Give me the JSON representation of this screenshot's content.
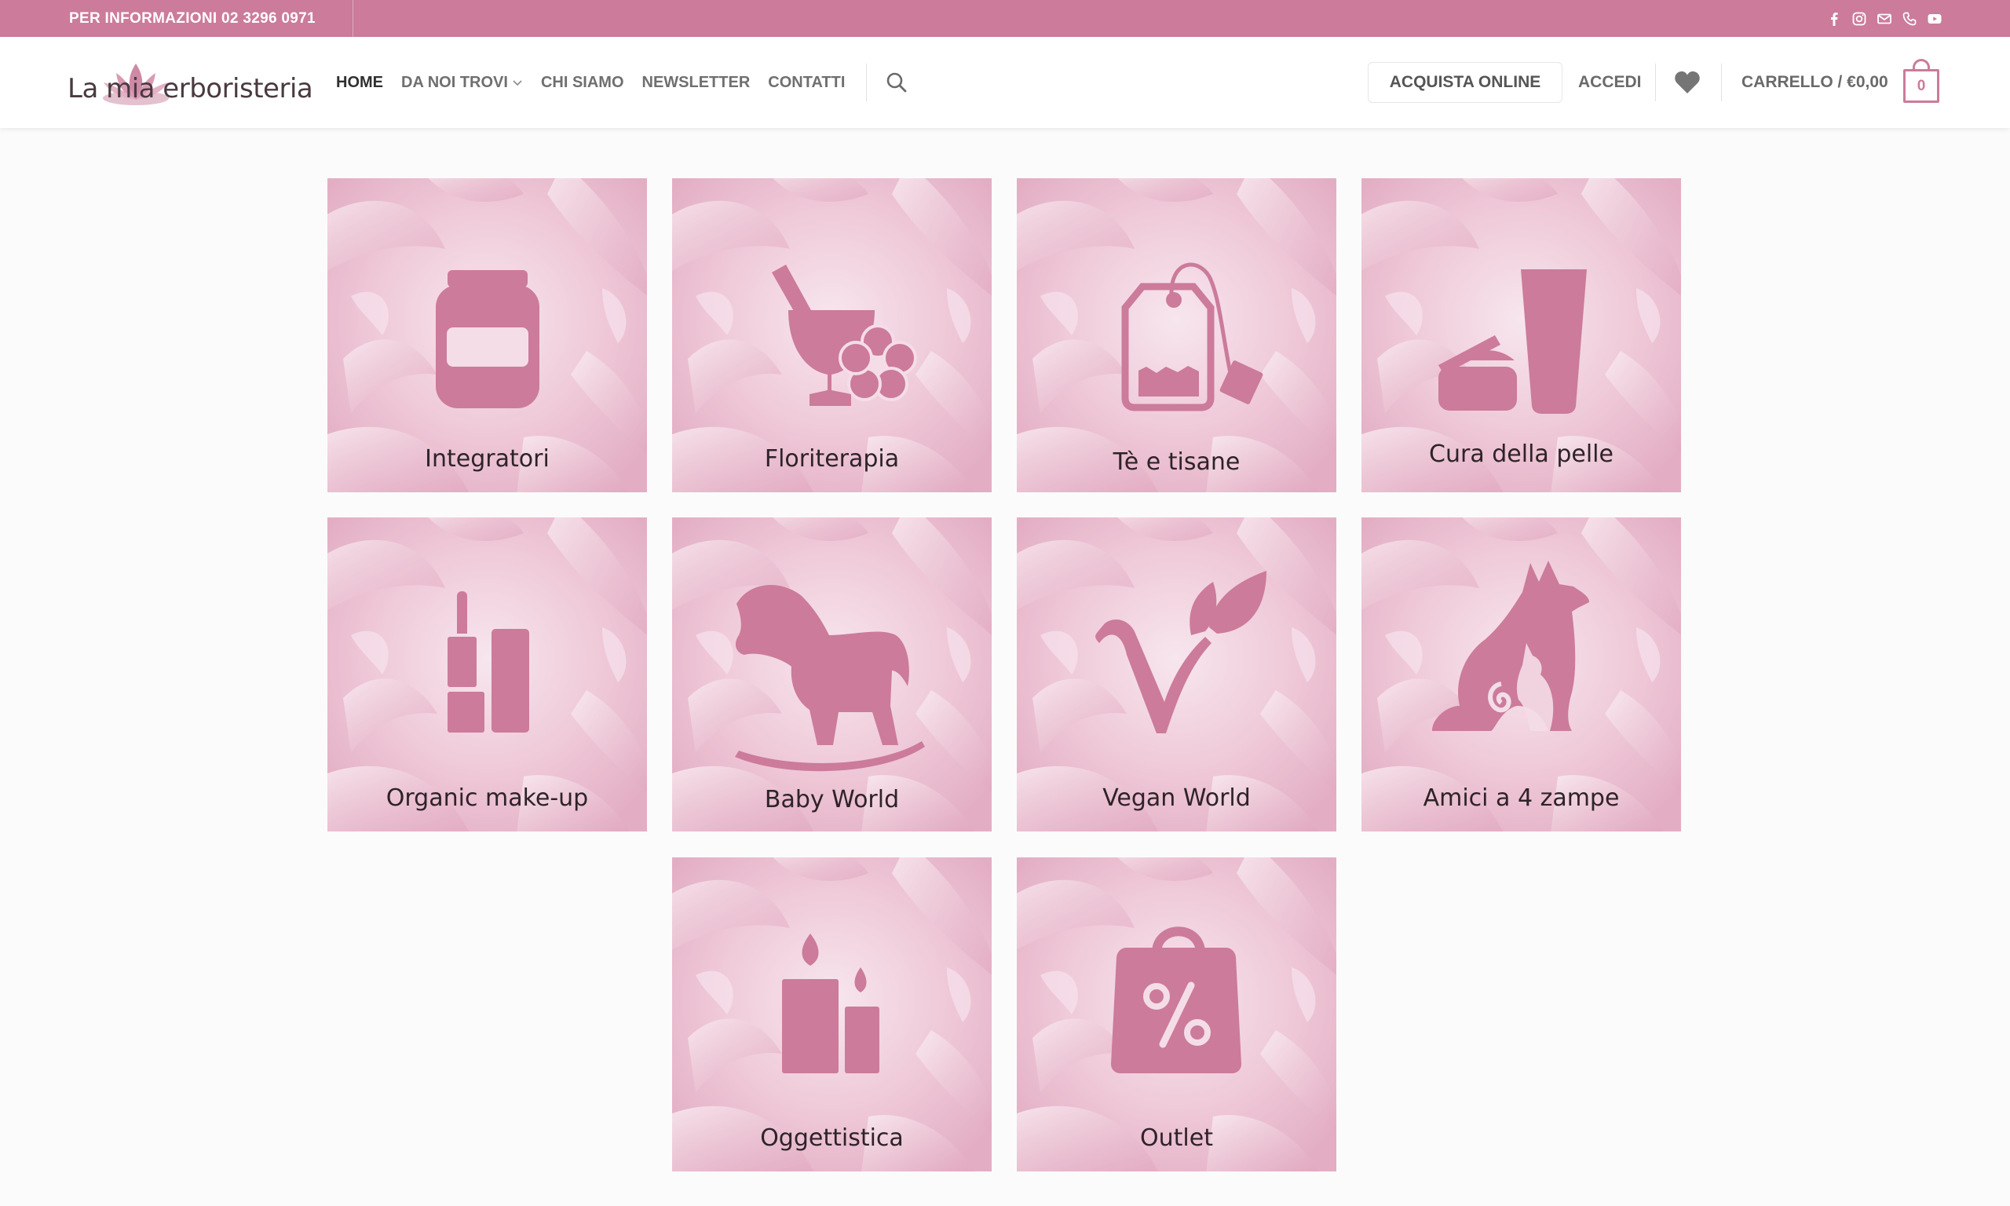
{
  "topbar": {
    "info": "PER INFORMAZIONI 02 3296 0971",
    "social_icons": [
      "facebook-icon",
      "instagram-icon",
      "email-icon",
      "phone-icon",
      "youtube-icon"
    ]
  },
  "header": {
    "logo_text": "La mia erboristeria",
    "nav": [
      {
        "label": "HOME",
        "active": true
      },
      {
        "label": "DA NOI TROVI",
        "has_dropdown": true
      },
      {
        "label": "CHI SIAMO"
      },
      {
        "label": "NEWSLETTER"
      },
      {
        "label": "CONTATTI"
      }
    ],
    "buy_online": "ACQUISTA ONLINE",
    "login": "ACCEDI",
    "cart_label": "CARRELLO / €0,00",
    "cart_count": "0"
  },
  "colors": {
    "brand": "#cc7b9a",
    "tile_background": "#f0cfdc",
    "icon": "#cc7b9a",
    "label": "#2e2328"
  },
  "categories": [
    {
      "label": "Integratori",
      "icon": "supplement-jar-icon"
    },
    {
      "label": "Floriterapia",
      "icon": "mortar-flower-icon"
    },
    {
      "label": "Tè e tisane",
      "icon": "tea-bag-icon"
    },
    {
      "label": "Cura della pelle",
      "icon": "skincare-icon"
    },
    {
      "label": "Organic make-up",
      "icon": "lipstick-icon"
    },
    {
      "label": "Baby World",
      "icon": "rocking-horse-icon"
    },
    {
      "label": "Vegan World",
      "icon": "vegan-leaf-icon"
    },
    {
      "label": "Amici a 4 zampe",
      "icon": "dog-cat-icon"
    },
    {
      "label": "Oggettistica",
      "icon": "candles-icon"
    },
    {
      "label": "Outlet",
      "icon": "sale-bag-icon"
    }
  ]
}
